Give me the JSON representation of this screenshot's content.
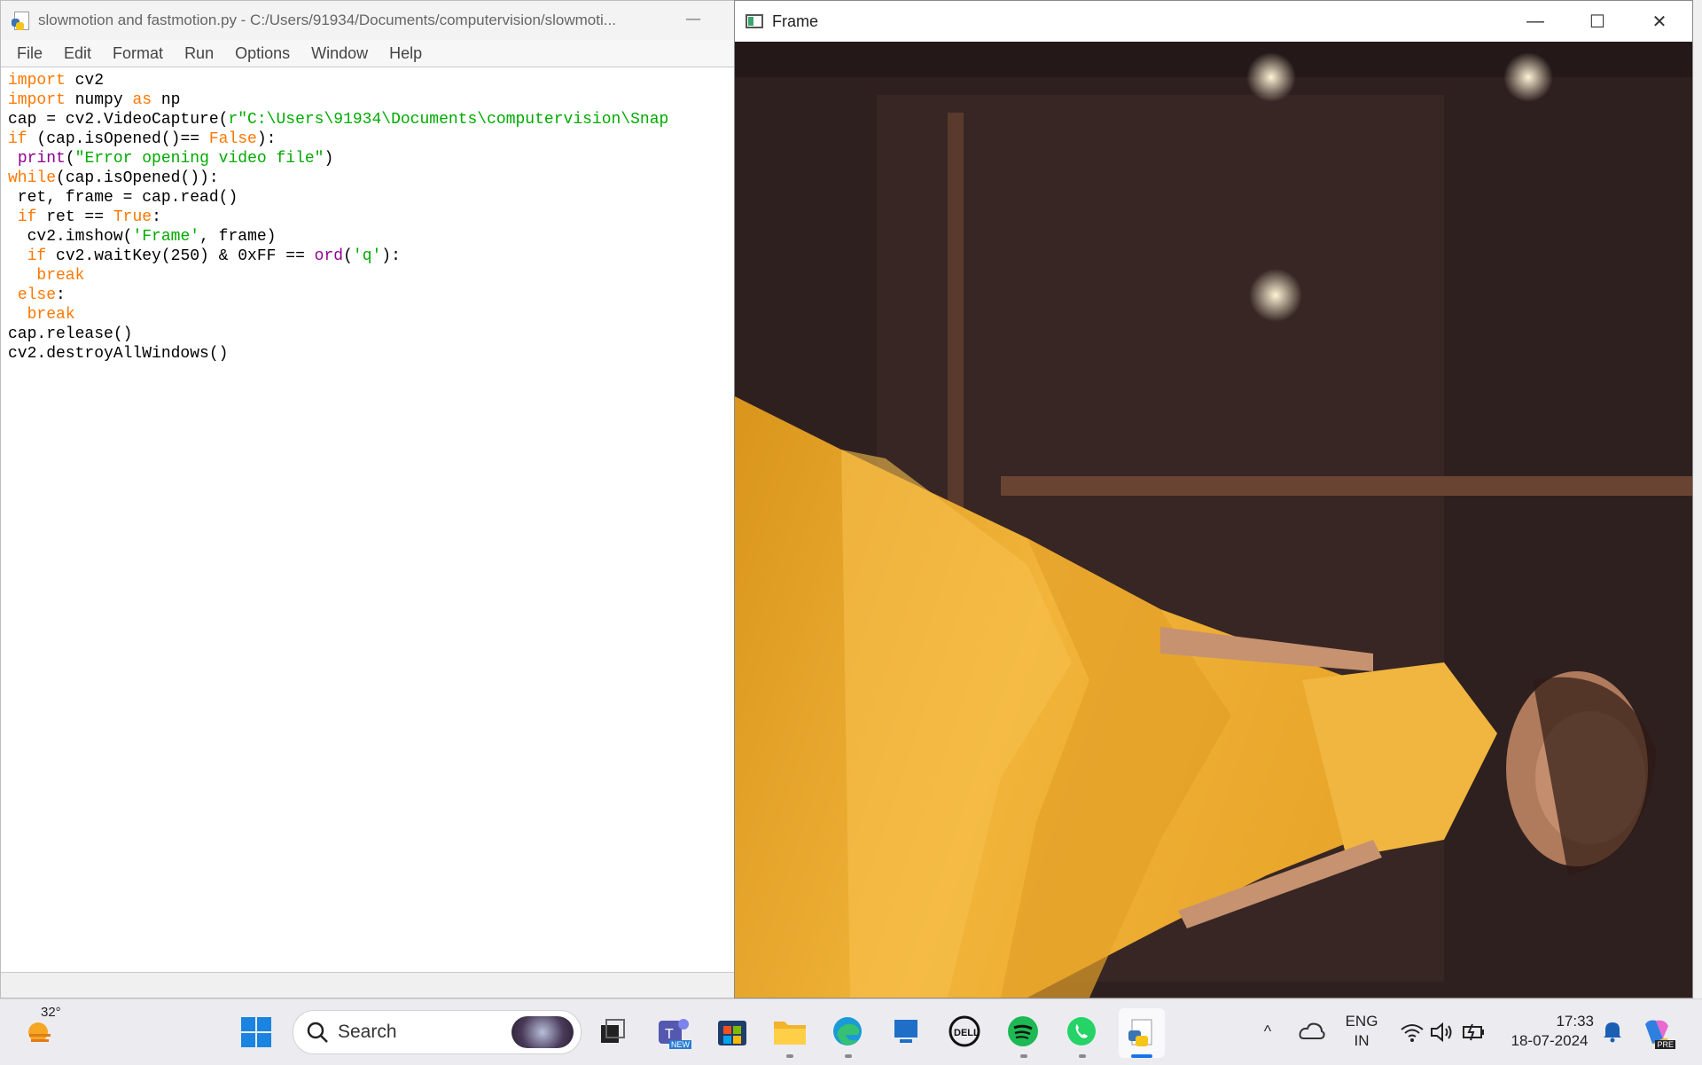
{
  "idle": {
    "title": "slowmotion and fastmotion.py - C:/Users/91934/Documents/computervision/slowmoti...",
    "minimize_glyph": "—",
    "menu": [
      "File",
      "Edit",
      "Format",
      "Run",
      "Options",
      "Window",
      "Help"
    ],
    "code": [
      [
        {
          "t": "import",
          "c": "kw"
        },
        {
          "t": " cv2"
        }
      ],
      [
        {
          "t": "import",
          "c": "kw"
        },
        {
          "t": " numpy "
        },
        {
          "t": "as",
          "c": "kw"
        },
        {
          "t": " np"
        }
      ],
      [
        {
          "t": "cap = cv2.VideoCapture("
        },
        {
          "t": "r\"C:\\Users\\91934\\Documents\\computervision\\Snap",
          "c": "st"
        }
      ],
      [
        {
          "t": "if",
          "c": "kw"
        },
        {
          "t": " (cap.isOpened()== "
        },
        {
          "t": "False",
          "c": "kw"
        },
        {
          "t": "):"
        }
      ],
      [
        {
          "t": " "
        },
        {
          "t": "print",
          "c": "bi"
        },
        {
          "t": "("
        },
        {
          "t": "\"Error opening video file\"",
          "c": "st"
        },
        {
          "t": ")"
        }
      ],
      [
        {
          "t": "while",
          "c": "kw"
        },
        {
          "t": "(cap.isOpened()):"
        }
      ],
      [
        {
          "t": " ret, frame = cap.read()"
        }
      ],
      [
        {
          "t": " "
        },
        {
          "t": "if",
          "c": "kw"
        },
        {
          "t": " ret == "
        },
        {
          "t": "True",
          "c": "kw"
        },
        {
          "t": ":"
        }
      ],
      [
        {
          "t": "  cv2.imshow("
        },
        {
          "t": "'Frame'",
          "c": "st"
        },
        {
          "t": ", frame)"
        }
      ],
      [
        {
          "t": "  "
        },
        {
          "t": "if",
          "c": "kw"
        },
        {
          "t": " cv2.waitKey(250) & 0xFF == "
        },
        {
          "t": "ord",
          "c": "bi"
        },
        {
          "t": "("
        },
        {
          "t": "'q'",
          "c": "st"
        },
        {
          "t": "):"
        }
      ],
      [
        {
          "t": "   "
        },
        {
          "t": "break",
          "c": "kw"
        }
      ],
      [
        {
          "t": " "
        },
        {
          "t": "else",
          "c": "kw"
        },
        {
          "t": ":"
        }
      ],
      [
        {
          "t": "  "
        },
        {
          "t": "break",
          "c": "kw"
        }
      ],
      [
        {
          "t": "cap.release()"
        }
      ],
      [
        {
          "t": "cv2.destroyAllWindows()"
        }
      ]
    ]
  },
  "frame_window": {
    "title": "Frame",
    "minimize_glyph": "—",
    "maximize_glyph": "☐",
    "close_glyph": "✕"
  },
  "taskbar": {
    "weather_temp": "32°",
    "search_label": "Search",
    "teams_badge": "NEW",
    "lang_line1": "ENG",
    "lang_line2": "IN",
    "time": "17:33",
    "date": "18-07-2024",
    "copilot_badge": "PRE"
  }
}
